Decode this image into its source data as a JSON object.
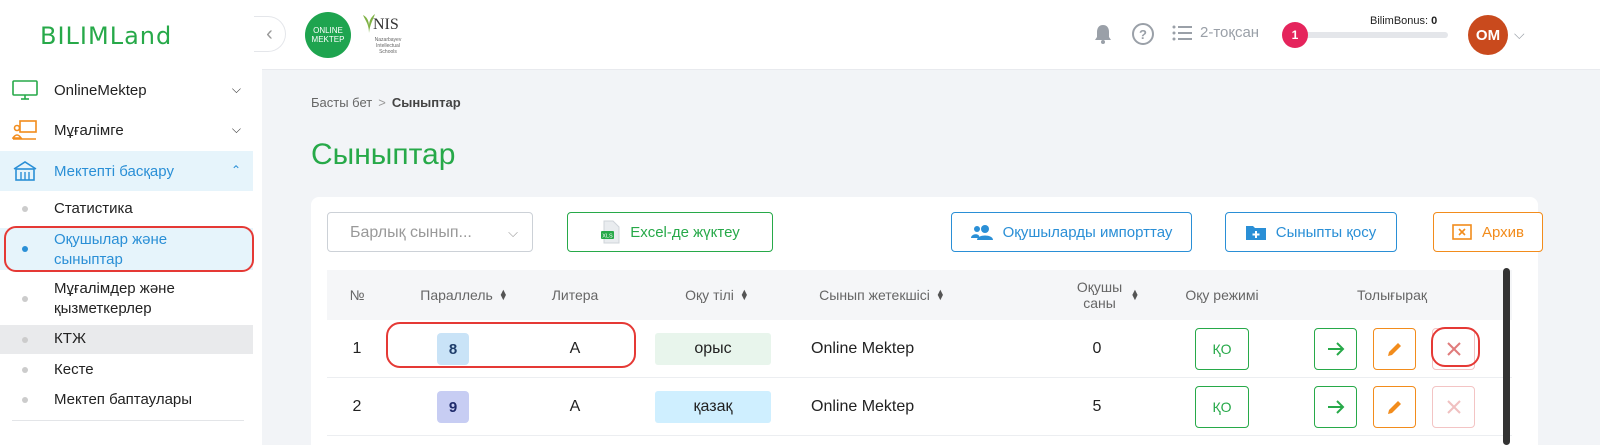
{
  "brand": {
    "logo_text": "BILIMLand"
  },
  "sidebar": {
    "items": [
      {
        "label": "OnlineMektep",
        "icon": "monitor-icon"
      },
      {
        "label": "Мұғалімге",
        "icon": "teacher-board-icon"
      },
      {
        "label": "Мектепті басқару",
        "icon": "school-building-icon"
      }
    ],
    "subitems": [
      {
        "label": "Статистика"
      },
      {
        "label": "Оқушылар және сыныптар"
      },
      {
        "label": "Мұғалімдер және қызметкерлер"
      },
      {
        "label": "КТЖ"
      },
      {
        "label": "Кесте"
      },
      {
        "label": "Мектеп баптаулары"
      }
    ]
  },
  "header": {
    "om_logo_line1": "ONLINE",
    "om_logo_line2": "MEKTEP",
    "nis_logo_text": "NIS",
    "nis_logo_sub": "Nazarbayev Intellectual Schools",
    "quarter": "2-тоқсан",
    "bonus_count": "1",
    "bonus_label": "BilimBonus:",
    "bonus_value": "0",
    "avatar_initials": "OM"
  },
  "breadcrumb": {
    "home": "Басты бет",
    "current": "Сыныптар"
  },
  "page_title": "Сыныптар",
  "toolbar": {
    "filter_placeholder": "Барлық сынып...",
    "excel_label": "Excel-де жүктеу",
    "import_label": "Оқушыларды импорттау",
    "add_label": "Сыныпты қосу",
    "archive_label": "Архив"
  },
  "table": {
    "headers": [
      "№",
      "Параллель",
      "Литера",
      "Оқу тілі",
      "Сынып жетекшісі",
      "Оқушы саны",
      "Оқу режимі",
      "Толығырақ"
    ],
    "rows": [
      {
        "num": "1",
        "parallel": "8",
        "litera": "А",
        "lang": "орыс",
        "teacher": "Online Mektep",
        "count": "0",
        "mode": "ҚО"
      },
      {
        "num": "2",
        "parallel": "9",
        "litera": "А",
        "lang": "қазақ",
        "teacher": "Online Mektep",
        "count": "5",
        "mode": "ҚО"
      }
    ]
  },
  "colors": {
    "brand_green": "#27a949",
    "accent_blue": "#2a8fd6",
    "accent_orange": "#f28c1c",
    "highlight_red": "#e53935",
    "lang_ru_bg": "#e8f5ec",
    "lang_kz_bg": "#cfefff",
    "par8_bg": "#c9e3f7",
    "par9_bg": "#c7cdf3"
  }
}
